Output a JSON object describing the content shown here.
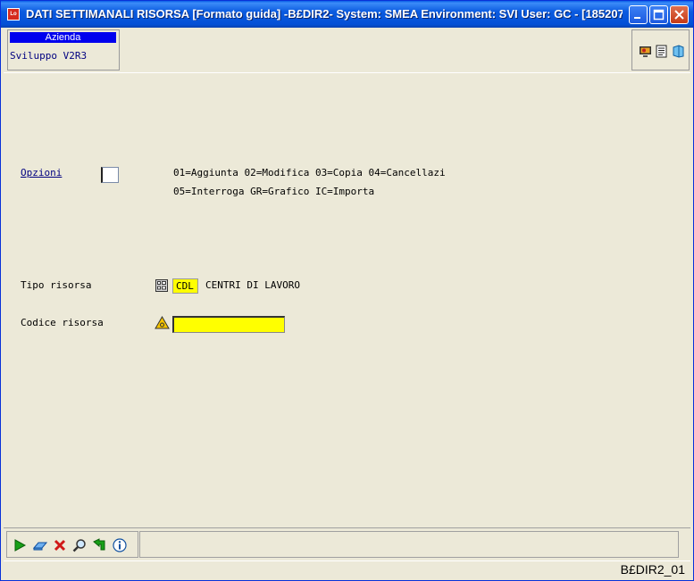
{
  "window": {
    "title": "DATI SETTIMANALI RISORSA [Formato guida] -B£DIR2- System: SMEA Environment: SVI User: GC - [185207-...",
    "app_icon_text": "Lo"
  },
  "header": {
    "azienda_label": "Azienda",
    "azienda_value": "Sviluppo V2R3"
  },
  "form": {
    "opzioni_label": "Opzioni",
    "opzioni_value": "",
    "options_line1": "01=Aggiunta 02=Modifica 03=Copia 04=Cancellazi",
    "options_line2": "05=Interroga GR=Grafico IC=Importa",
    "tipo_risorsa_label": "Tipo risorsa",
    "tipo_risorsa_code": "CDL",
    "tipo_risorsa_desc": "CENTRI DI LAVORO",
    "codice_risorsa_label": "Codice risorsa",
    "codice_risorsa_value": ""
  },
  "statusbar": {
    "program_id": "B£DIR2_01"
  },
  "colors": {
    "titlebar": "#0450D6",
    "required_field": "#FFFF00",
    "link": "#000080",
    "azienda_header": "#0000EE"
  }
}
